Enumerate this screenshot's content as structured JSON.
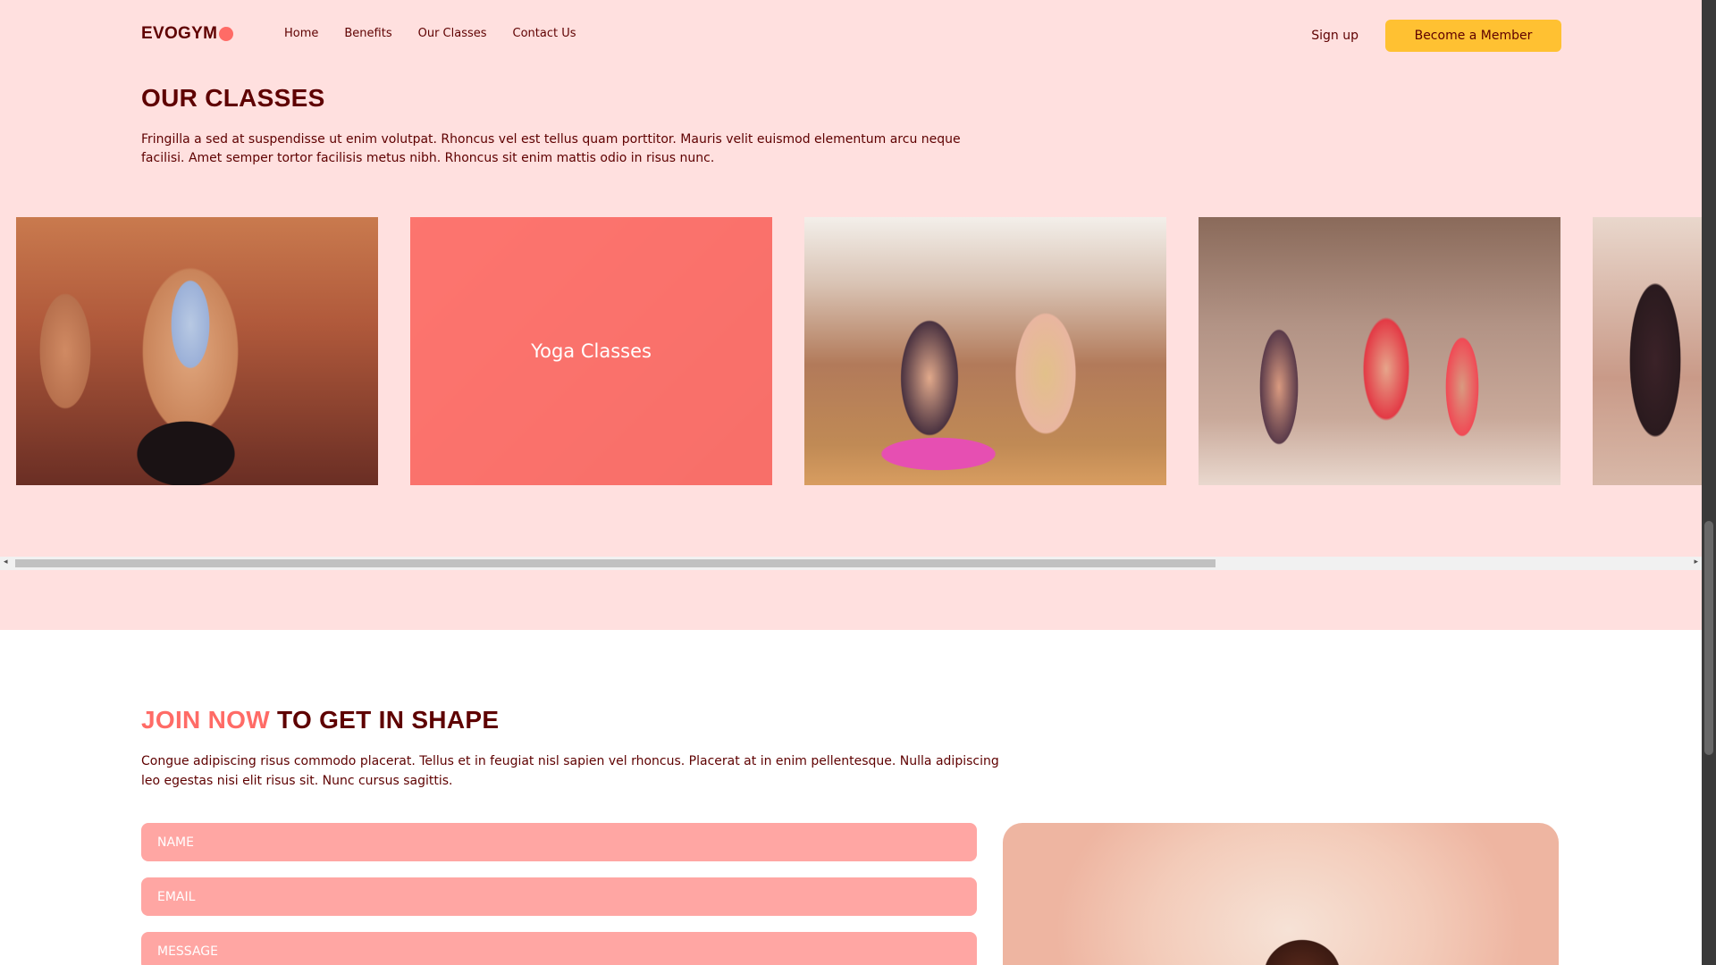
{
  "nav": {
    "logo": "EVOGYM",
    "links": [
      "Home",
      "Benefits",
      "Our Classes",
      "Contact Us"
    ],
    "signup": "Sign up",
    "member_button": "Become a Member",
    "accent_color": "#ff6b66",
    "button_color": "#ffc132"
  },
  "classes": {
    "title": "OUR CLASSES",
    "text": "Fringilla a sed at suspendisse ut enim volutpat. Rhoncus vel est tellus quam porttitor. Mauris velit euismod elementum arcu neque facilisi. Amet semper tortor facilisis metus nibh. Rhoncus sit enim mattis odio in risus nunc.",
    "hovered_card_label": "Yoga Classes",
    "background_color": "#ffe0df"
  },
  "join": {
    "title_accent": "JOIN NOW",
    "title_rest": " TO GET IN SHAPE",
    "text": "Congue adipiscing risus commodo placerat. Tellus et in feugiat nisl sapien vel rhoncus. Placerat at in enim pellentesque. Nulla adipiscing leo egestas nisi elit risus sit. Nunc cursus sagittis.",
    "fields": {
      "name": "NAME",
      "email": "EMAIL",
      "message": "MESSAGE"
    },
    "field_color": "#ffa6a3"
  },
  "icons": {
    "scroll_left": "◂",
    "scroll_right": "▸"
  }
}
